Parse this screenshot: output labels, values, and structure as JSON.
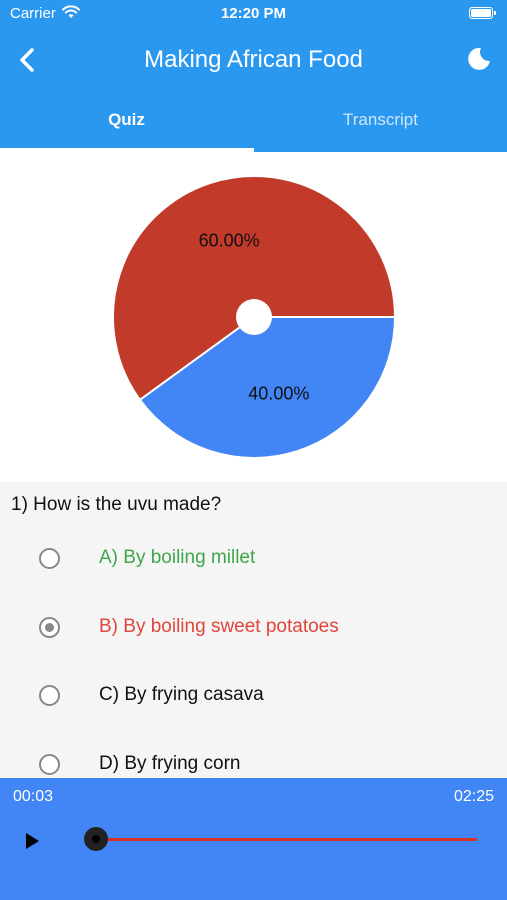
{
  "status_bar": {
    "carrier": "Carrier",
    "time": "12:20 PM"
  },
  "header": {
    "title": "Making African Food"
  },
  "tabs": [
    {
      "label": "Quiz",
      "active": true
    },
    {
      "label": "Transcript",
      "active": false
    }
  ],
  "chart_data": {
    "type": "pie",
    "slices": [
      {
        "label": "60.00%",
        "value": 60,
        "color": "#c13a2a"
      },
      {
        "label": "40.00%",
        "value": 40,
        "color": "#4285f4"
      }
    ]
  },
  "question": {
    "text": "1) How is the uvu made?",
    "options": [
      {
        "label": "A) By boiling millet",
        "selected": false,
        "color": "#3ea64a"
      },
      {
        "label": "B) By boiling sweet potatoes",
        "selected": true,
        "color": "#e0463b"
      },
      {
        "label": "C) By frying casava",
        "selected": false,
        "color": "#111111"
      },
      {
        "label": "D) By frying corn",
        "selected": false,
        "color": "#111111"
      }
    ]
  },
  "player": {
    "current_time": "00:03",
    "total_time": "02:25",
    "progress": 0.02
  },
  "colors": {
    "accent": "#2b98f0",
    "player_bg": "#4285f4",
    "track": "#d93025"
  }
}
